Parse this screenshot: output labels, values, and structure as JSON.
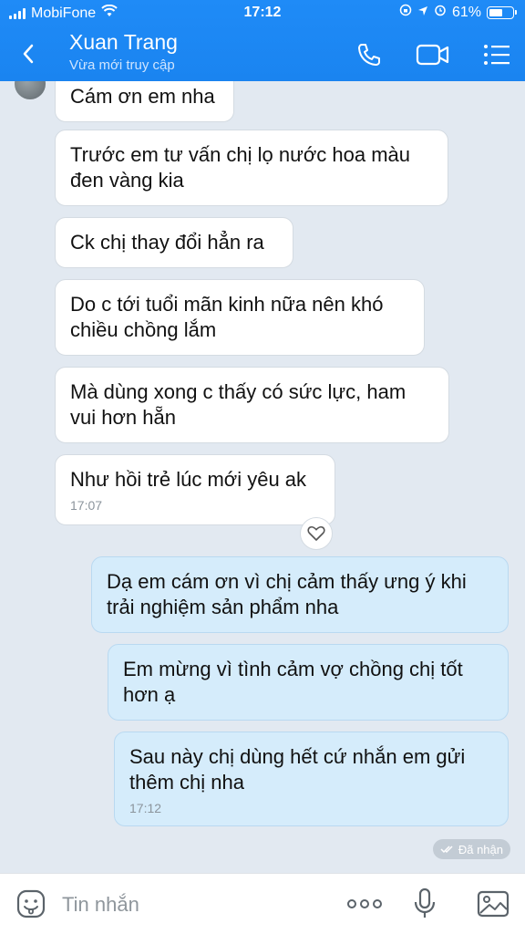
{
  "status_bar": {
    "carrier": "MobiFone",
    "time": "17:12",
    "battery": "61%",
    "battery_level": 0.61
  },
  "header": {
    "contact_name": "Xuan Trang",
    "contact_status": "Vừa mới truy cập",
    "icons": [
      "back-chevron-icon",
      "phone-icon",
      "video-call-icon",
      "menu-list-icon"
    ]
  },
  "messages": [
    {
      "side": "in",
      "text": "Cám ơn em nha"
    },
    {
      "side": "in",
      "text": "Trước em tư vấn chị lọ nước hoa màu đen vàng kia"
    },
    {
      "side": "in",
      "text": "Ck chị thay đổi hẳn ra"
    },
    {
      "side": "in",
      "text": "Do c tới tuổi mãn kinh nữa nên khó chiều chồng lắm"
    },
    {
      "side": "in",
      "text": "Mà dùng xong c thấy có sức lực, ham vui hơn hẵn"
    },
    {
      "side": "in",
      "text": "Như hồi trẻ lúc mới yêu ak",
      "time": "17:07"
    },
    {
      "side": "out",
      "text": "Dạ em cám ơn vì chị cảm thấy ưng ý khi trải nghiệm sản phẩm nha"
    },
    {
      "side": "out",
      "text": "Em mừng vì tình cảm vợ chồng chị tốt hơn ạ"
    },
    {
      "side": "out",
      "text": "Sau này chị dùng hết cứ nhắn em gửi thêm chị nha",
      "time": "17:12"
    }
  ],
  "reaction_icon": "heart-outline-icon",
  "delivery_status": "Đã nhận",
  "input_bar": {
    "placeholder": "Tin nhắn",
    "icons": [
      "sticker-icon",
      "more-dots-icon",
      "microphone-icon",
      "image-icon"
    ]
  },
  "colors": {
    "header_bg": "#1a84f0",
    "chat_bg": "#e2e9f1",
    "incoming_bubble": "#ffffff",
    "outgoing_bubble": "#d5ecfb"
  }
}
